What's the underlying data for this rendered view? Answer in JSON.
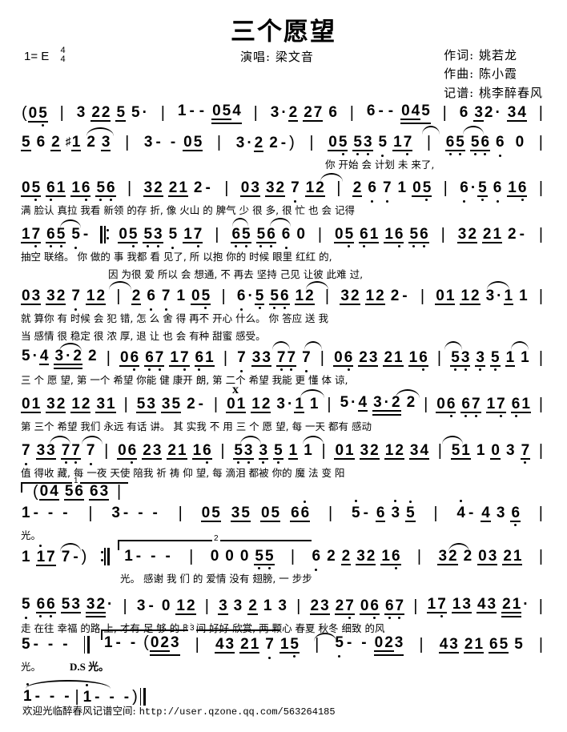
{
  "header": {
    "title": "三个愿望",
    "key_label": "1= E",
    "meter_num": "4",
    "meter_den": "4",
    "singer": "演唱: 梁文音",
    "credits": [
      "作词: 姚若龙",
      "作曲: 陈小霞",
      "记谱: 桃李醉春风"
    ]
  },
  "systems": [
    {
      "id": "system-1",
      "notes": "( 05 | 3 22 5 5· | 1 - - 054 | 3 ·2 27 6 | 6 - - 045 | 6 3 2· 34 |",
      "lyrics": ""
    },
    {
      "id": "system-2",
      "notes": "5 6 2 #1 2 3 | 3 - - 05 | 3 ·2 2 - ) | 05 53 5 17 | 65 56 6 0 |",
      "lyrics": "你 开始 会 计划   未 来了,"
    },
    {
      "id": "system-3",
      "notes": "05 61 16 56 | 32 21 2 - | 03 32 7 12 | 2 6 7 1 05 | 6 ·5 6 16 |",
      "lyrics": "满 脸认 真拉 我看   新领 的存 折,   像 火山 的 脾气   少 很 多, 很   忙 也 会 记得"
    },
    {
      "id": "system-4",
      "notes": "17 65 5 - ‖: 05 53 5 17 | 65 56 6 0 | 05 61 16 56 | 32 21 2 - |",
      "lyrics1": "抽空 联络。   你 做的 事 我都   看   见了,   所 以抱 你的 时候   眼里 红红 的,",
      "lyrics2": "因 为很 爱 所以   会   想通,   不 再去 坚持 己见   让彼 此难 过,"
    },
    {
      "id": "system-5",
      "notes": "03 32 7 12 | 2 6 7 1 05 | 6 ·5 56 12 | 32 12 2 - | 01 12 3·1 1 |",
      "lyrics1": "就 算你 有 时候   会 犯 错, 怎   么 舍   得 再不   开心 什么。   你 答应 送   我",
      "lyrics2": "当 感情 很 稳定   很 浓 厚, 退   让 也   会 有种   甜蜜 感受。"
    },
    {
      "id": "system-6",
      "notes": "5 ·4 3·2 2 | 06 67 17 61 | 7 33 77 7 | 06 23 21 16 | 53 3 5 1 1 |",
      "lyrics": "三 个 愿   望,   第 一个 希望 你能   健 康开   朗,   第 二个 希望 我能   更   懂 体 谅,"
    },
    {
      "id": "system-7",
      "notes": "01 32 12 31 | 53 35 2 - | 01 12 3·1 1 | 5·4 3·2 2 | 06 67 17 61 |",
      "lyrics": "第 三个 希望 我们   永远 有话 讲。   其 实我 不   用   三 个 愿   望,   每 一天 都有 感动"
    },
    {
      "id": "system-8",
      "notes": "7 33 77 7 | 06 23 21 16 | 53 3 5 1 1 | 01 32 12 34 | 51 1 0 3 7 |",
      "lyrics": "值 得收   藏,   每 一夜 天使 陪我   祈   祷 仰 望,   每 滴泪 都被 你的   魔   法   变 阳"
    },
    {
      "id": "system-9",
      "volta": "1",
      "pickup": "( 04 56 63 |",
      "notes": "1 - - -  | 3 - - - | 05 35 05 66 | 5 - 6 3 5 | 4 - 4 3 6 |",
      "lyrics": "光。"
    },
    {
      "id": "system-10",
      "volta": "2",
      "notes": "1 i7 7 - ) :‖ 1 - - - | 0 0 0 55 | 6 2 2 32 16 | 32 2 03 21 |",
      "lyrics": "光。   感谢   我 们 的  爱情 没有   翅膀,   一 步步"
    },
    {
      "id": "system-11",
      "notes": "5 66 53 32· | 3 - 0 12 | 3 3 2 1 3 | 23 27 06 67 | 17 13 43 21· |",
      "lyrics": "走 在往 幸福 的路   上,   才有   足 够 的 时 间   好好 欣赏, 两 颗心   春夏 秋冬 细致 的风"
    },
    {
      "id": "system-12",
      "volta": "3",
      "notes": "5 - - - ‖ 1 - - ( 023 | 43 21 7 15 | 5 - - 023 | 43 21 65 5 |",
      "lyrics": "光。     D.S 光。"
    },
    {
      "id": "system-13",
      "notes": "1 - - - | 1 - - - ) ‖",
      "lyrics": ""
    }
  ],
  "footer": {
    "text": "欢迎光临醉春风记谱空间:",
    "url": "http://user.qzone.qq.com/563264185"
  },
  "colors": {
    "ink": "#000000",
    "paper": "#ffffff"
  }
}
